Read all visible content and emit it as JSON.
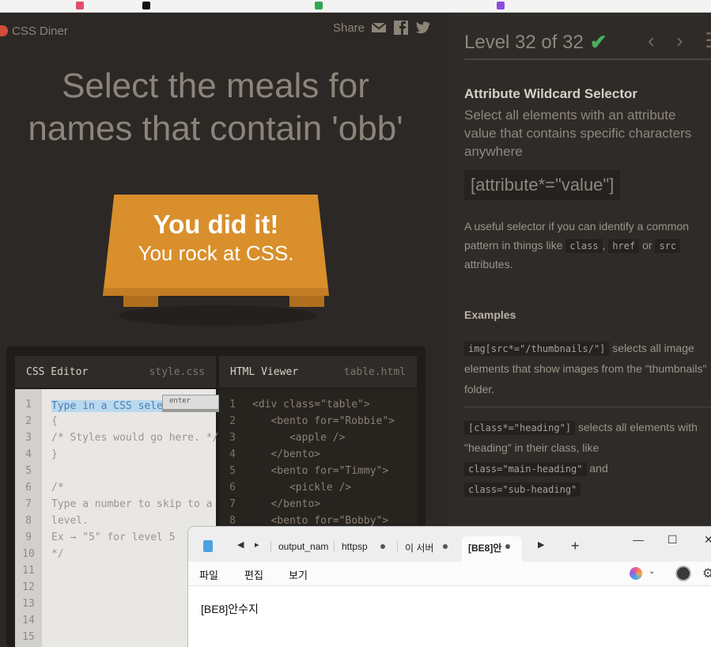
{
  "left": {
    "brand": "CSS Diner",
    "share_label": "Share",
    "order": [
      "Select the meals for",
      "names that contain 'obb'"
    ],
    "win_big": "You did it!",
    "win_small": "You rock at CSS.",
    "css_editor": {
      "title": "CSS Editor",
      "file": "style.css",
      "placeholder": "Type in a CSS selector",
      "enter_label": "enter",
      "line_numbers": [
        "1",
        "2",
        "3",
        "4",
        "5",
        "6",
        "7",
        "8",
        "9",
        "10",
        "11",
        "12",
        "13",
        "14",
        "15"
      ],
      "lines": [
        "{",
        "/* Styles would go here. */",
        "}",
        "",
        "/*",
        "Type a number to skip to a",
        "level.",
        "Ex → \"5\" for level 5",
        "*/"
      ]
    },
    "html_viewer": {
      "title": "HTML Viewer",
      "file": "table.html",
      "line_numbers": [
        "1",
        "2",
        "3",
        "4",
        "5",
        "6",
        "7",
        "8"
      ],
      "lines": [
        "<div class=\"table\">",
        "   <bento for=\"Robbie\">",
        "      <apple />",
        "   </bento>",
        "   <bento for=\"Timmy\">",
        "      <pickle />",
        "   </bento>",
        "   <bento for=\"Bobby\">"
      ]
    }
  },
  "right": {
    "level": "Level 32 of 32",
    "check": "✔",
    "prev": "‹",
    "next": "›",
    "menu": "☰",
    "title": "Attribute Wildcard Selector",
    "subtitle": "Select all elements with an attribute value that contains specific characters anywhere",
    "syntax": "[attribute*=\"value\"]",
    "hint_pre": "A useful selector if you can identify a common pattern in things like",
    "hint_chips": [
      "class",
      "href",
      "src"
    ],
    "hint_sep1": ",",
    "hint_or": "or",
    "hint_post": "attributes.",
    "examples_heading": "Examples",
    "ex1_code": "img[src*=\"/thumbnails/\"]",
    "ex1_text": "selects all image elements that show images from the \"thumbnails\" folder.",
    "ex2_code": "[class*=\"heading\"]",
    "ex2_text": "selects all elements with \"heading\" in their class, like",
    "ex2_chip1": "class=\"main-heading\"",
    "ex2_and": "and",
    "ex2_chip2": "class=\"sub-heading\""
  },
  "notepad": {
    "tabs": [
      "output_nam",
      "httpsp",
      "이 서버",
      "[BE8]안"
    ],
    "menu": [
      "파일",
      "편집",
      "보기"
    ],
    "content": "[BE8]안수지",
    "minimize": "—",
    "maximize": "☐",
    "close": "✕",
    "add_tab": "+"
  },
  "colors": {
    "accent_check": "#48b05b",
    "table": "#d98f2b",
    "bg": "#2c2826"
  }
}
